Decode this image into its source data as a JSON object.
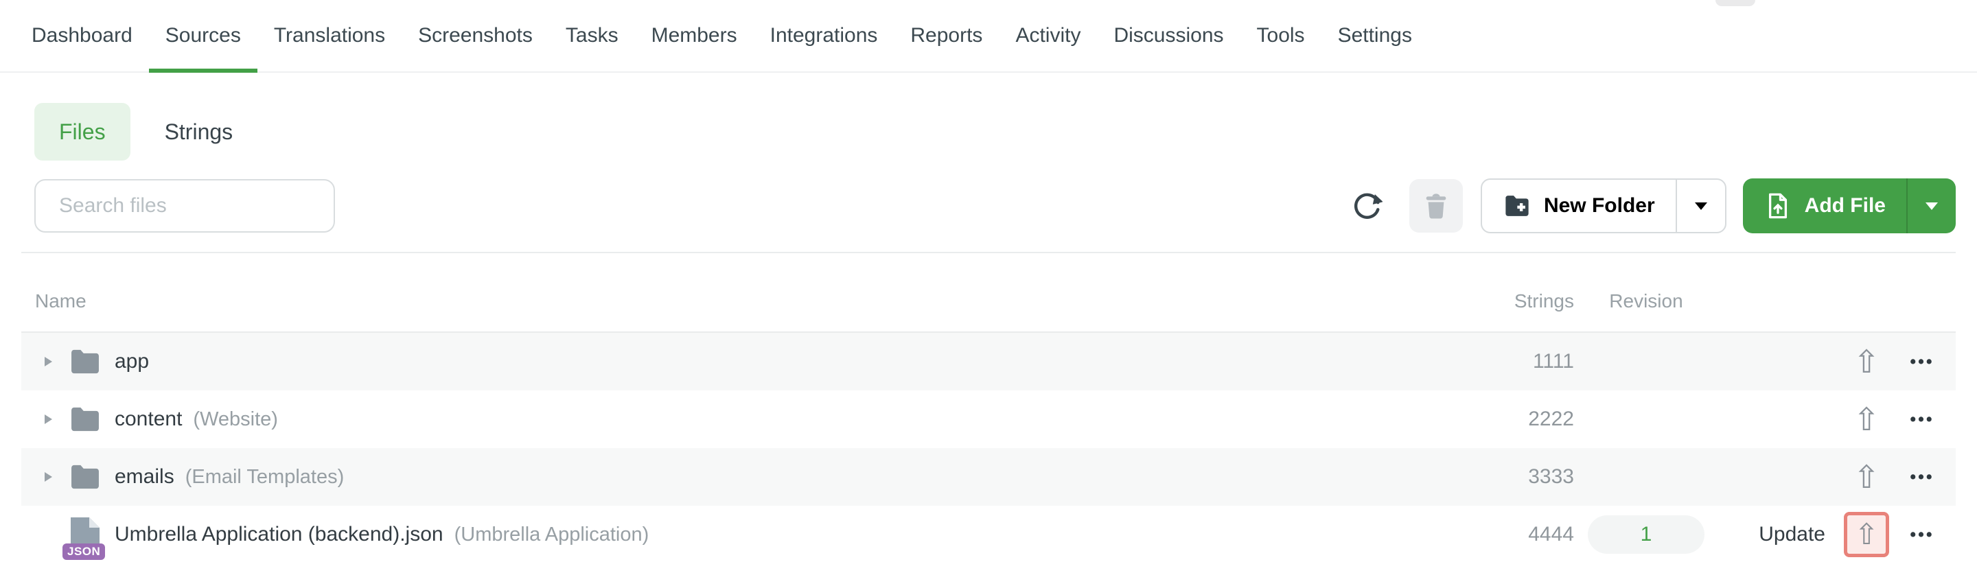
{
  "nav": {
    "items": [
      {
        "label": "Dashboard",
        "active": false
      },
      {
        "label": "Sources",
        "active": true
      },
      {
        "label": "Translations",
        "active": false
      },
      {
        "label": "Screenshots",
        "active": false
      },
      {
        "label": "Tasks",
        "active": false
      },
      {
        "label": "Members",
        "active": false
      },
      {
        "label": "Integrations",
        "active": false
      },
      {
        "label": "Reports",
        "active": false
      },
      {
        "label": "Activity",
        "active": false
      },
      {
        "label": "Discussions",
        "active": false
      },
      {
        "label": "Tools",
        "active": false
      },
      {
        "label": "Settings",
        "active": false
      }
    ]
  },
  "tabs": {
    "files_label": "Files",
    "strings_label": "Strings"
  },
  "toolbar": {
    "search_placeholder": "Search files",
    "new_folder_label": "New Folder",
    "add_file_label": "Add File"
  },
  "table": {
    "headers": {
      "name": "Name",
      "strings": "Strings",
      "revision": "Revision"
    },
    "rows": [
      {
        "type": "folder",
        "name": "app",
        "annotation": "",
        "strings": "1111"
      },
      {
        "type": "folder",
        "name": "content",
        "annotation": "(Website)",
        "strings": "2222"
      },
      {
        "type": "folder",
        "name": "emails",
        "annotation": "(Email Templates)",
        "strings": "3333"
      },
      {
        "type": "file",
        "name": "Umbrella Application (backend).json",
        "annotation": "(Umbrella Application)",
        "strings": "4444",
        "revision": "1",
        "update_label": "Update",
        "file_type_badge": "JSON"
      }
    ]
  },
  "colors": {
    "accent_green": "#43a047",
    "files_pill_bg": "#e7f4e8",
    "highlight_red_border": "#e8827a",
    "highlight_red_bg": "#fcebe9",
    "json_badge_purple": "#9a6db4",
    "row_alt_bg": "#f7f8f8"
  }
}
